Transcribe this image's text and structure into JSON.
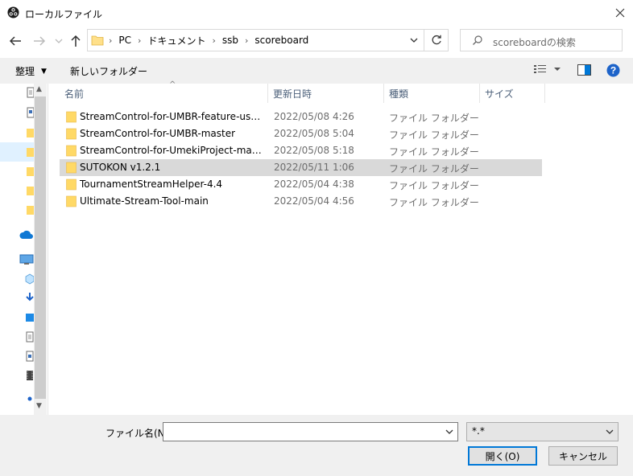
{
  "window": {
    "title": "ローカルファイル"
  },
  "navigation": {
    "breadcrumbs": [
      "PC",
      "ドキュメント",
      "ssb",
      "scoreboard"
    ],
    "search_placeholder": "scoreboardの検索"
  },
  "toolbar": {
    "organize_label": "整理",
    "new_folder_label": "新しいフォルダー"
  },
  "columns": {
    "name": "名前",
    "date": "更新日時",
    "type": "種類",
    "size": "サイズ"
  },
  "files": [
    {
      "name": "StreamControl-for-UMBR-feature-use_nu...",
      "date": "2022/05/08 4:26",
      "type": "ファイル フォルダー",
      "selected": false
    },
    {
      "name": "StreamControl-for-UMBR-master",
      "date": "2022/05/08 5:04",
      "type": "ファイル フォルダー",
      "selected": false
    },
    {
      "name": "StreamControl-for-UmekiProject-master",
      "date": "2022/05/08 5:18",
      "type": "ファイル フォルダー",
      "selected": false
    },
    {
      "name": "SUTOKON v1.2.1",
      "date": "2022/05/11 1:06",
      "type": "ファイル フォルダー",
      "selected": true
    },
    {
      "name": "TournamentStreamHelper-4.4",
      "date": "2022/05/04 4:38",
      "type": "ファイル フォルダー",
      "selected": false
    },
    {
      "name": "Ultimate-Stream-Tool-main",
      "date": "2022/05/04 4:56",
      "type": "ファイル フォルダー",
      "selected": false
    }
  ],
  "footer": {
    "filename_label": "ファイル名(N):",
    "filename_value": "",
    "filetype_value": "*.*",
    "open_label": "開く(O)",
    "cancel_label": "キャンセル"
  },
  "colors": {
    "folder": "#ffd966",
    "folder_dark": "#e8b84a",
    "selection": "#d9d9d9",
    "accent": "#0078d7"
  }
}
